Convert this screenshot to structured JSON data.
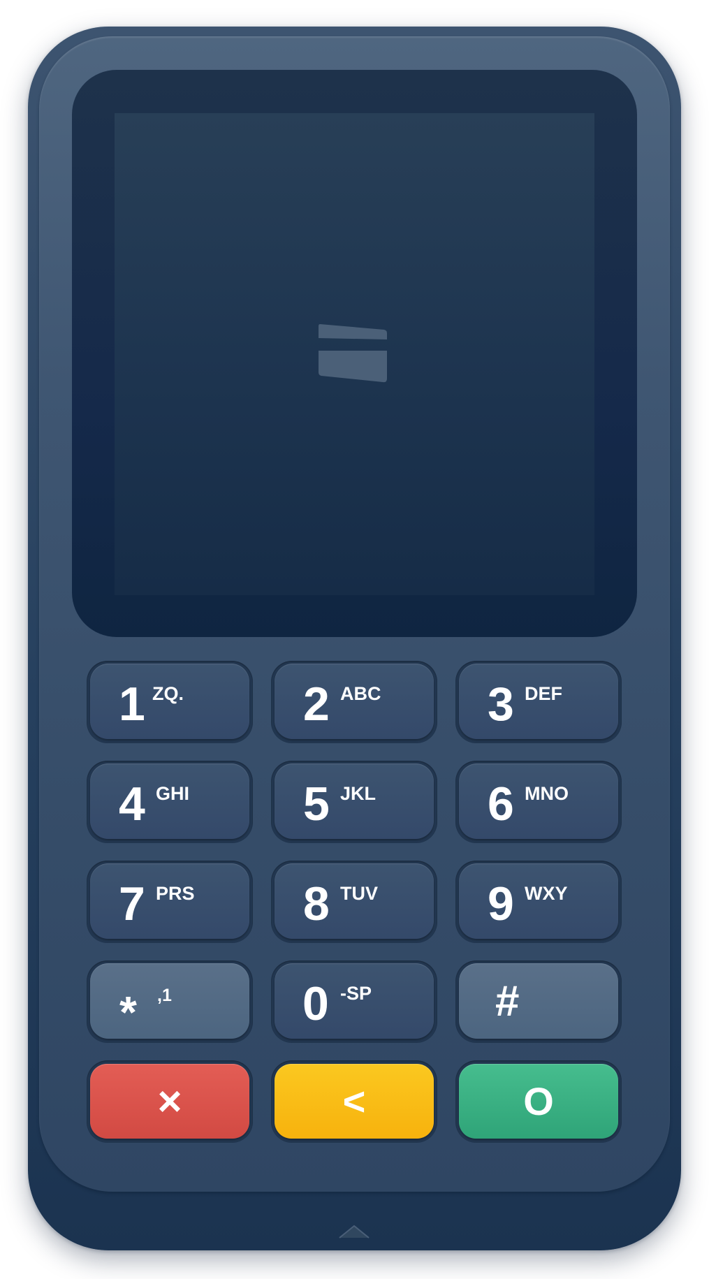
{
  "device": {
    "colors": {
      "body": "#3f5672",
      "screen": "#1e3550",
      "cancel": "#d24a43",
      "clear": "#f7b20d",
      "enter": "#2fa478"
    }
  },
  "screen": {
    "icon": "card-icon"
  },
  "keypad": {
    "keys": [
      {
        "digit": "1",
        "letters": "ZQ."
      },
      {
        "digit": "2",
        "letters": "ABC"
      },
      {
        "digit": "3",
        "letters": "DEF"
      },
      {
        "digit": "4",
        "letters": "GHI"
      },
      {
        "digit": "5",
        "letters": "JKL"
      },
      {
        "digit": "6",
        "letters": "MNO"
      },
      {
        "digit": "7",
        "letters": "PRS"
      },
      {
        "digit": "8",
        "letters": "TUV"
      },
      {
        "digit": "9",
        "letters": "WXY"
      },
      {
        "digit": "*",
        "letters": ",1"
      },
      {
        "digit": "0",
        "letters": "-SP"
      },
      {
        "digit": "#",
        "letters": ""
      }
    ],
    "function_keys": {
      "cancel": {
        "label": "×",
        "icon": "close-icon"
      },
      "clear": {
        "label": "<",
        "icon": "backspace-icon"
      },
      "enter": {
        "label": "O",
        "icon": "confirm-icon"
      }
    }
  }
}
